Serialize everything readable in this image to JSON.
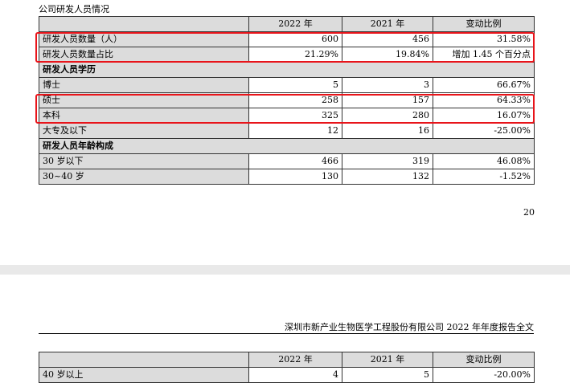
{
  "page1": {
    "caption": "公司研发人员情况",
    "page_number": "20",
    "table": {
      "header": [
        "",
        "2022 年",
        "2021 年",
        "变动比例"
      ],
      "rows": [
        {
          "kind": "row",
          "cells": [
            "研发人员数量（人）",
            "600",
            "456",
            "31.58%"
          ]
        },
        {
          "kind": "row",
          "cells": [
            "研发人员数量占比",
            "21.29%",
            "19.84%",
            "增加 1.45 个百分点"
          ]
        },
        {
          "kind": "section",
          "cells": [
            "研发人员学历"
          ]
        },
        {
          "kind": "row",
          "cells": [
            "博士",
            "5",
            "3",
            "66.67%"
          ]
        },
        {
          "kind": "row",
          "cells": [
            "硕士",
            "258",
            "157",
            "64.33%"
          ]
        },
        {
          "kind": "row",
          "cells": [
            "本科",
            "325",
            "280",
            "16.07%"
          ]
        },
        {
          "kind": "row",
          "cells": [
            "大专及以下",
            "12",
            "16",
            "-25.00%"
          ]
        },
        {
          "kind": "section",
          "cells": [
            "研发人员年龄构成"
          ]
        },
        {
          "kind": "row",
          "cells": [
            "30 岁以下",
            "466",
            "319",
            "46.08%"
          ]
        },
        {
          "kind": "row",
          "cells": [
            "30~40 岁",
            "130",
            "132",
            "-1.52%"
          ]
        }
      ]
    }
  },
  "page2": {
    "header_text": "深圳市新产业生物医学工程股份有限公司 2022 年年度报告全文",
    "table": {
      "header": [
        "",
        "2022 年",
        "2021 年",
        "变动比例"
      ],
      "rows": [
        {
          "kind": "row",
          "cells": [
            "40 岁以上",
            "4",
            "5",
            "-20.00%"
          ]
        }
      ]
    }
  },
  "colors": {
    "highlight": "#e8141a",
    "cell_shade": "#dcdcdc",
    "page_gap": "#e9e9e9"
  }
}
